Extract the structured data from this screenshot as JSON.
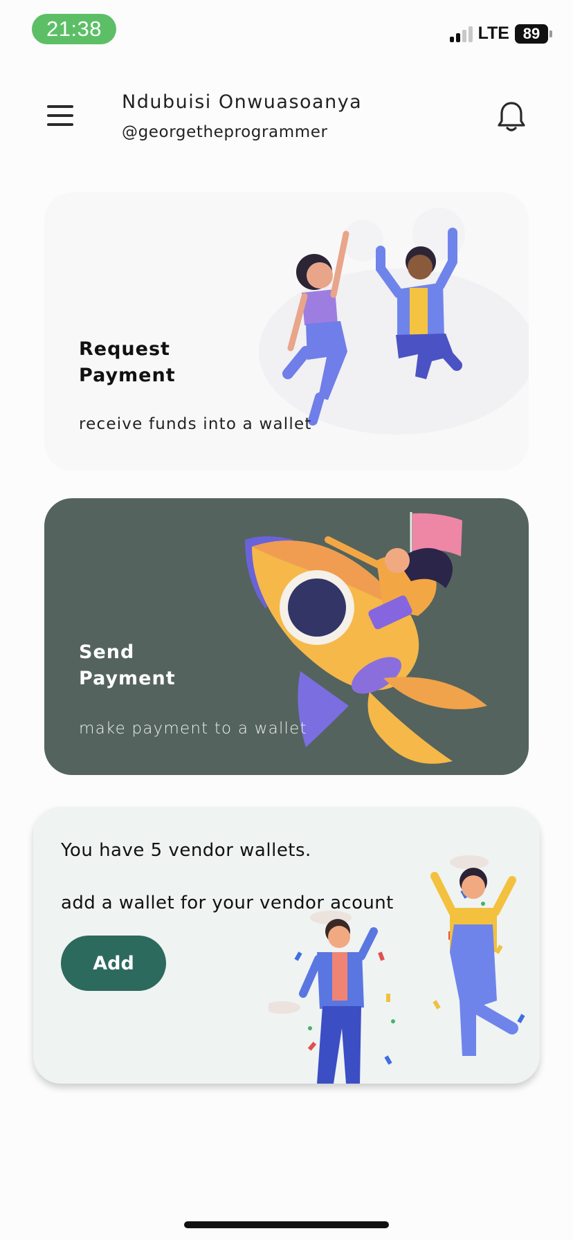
{
  "status_bar": {
    "time": "21:38",
    "network": "LTE",
    "battery": "89"
  },
  "header": {
    "name": "Ndubuisi Onwuasoanya",
    "handle": "@georgetheprogrammer"
  },
  "cards": {
    "request": {
      "title_line1": "Request",
      "title_line2": "Payment",
      "subtitle": "receive funds into a wallet"
    },
    "send": {
      "title_line1": "Send",
      "title_line2": "Payment",
      "subtitle": "make payment to a wallet"
    },
    "vendor": {
      "title": "You have 5 vendor wallets.",
      "subtitle": "add a wallet for your vendor acount",
      "button_label": "Add"
    }
  },
  "icons": {
    "menu": "hamburger-menu-icon",
    "notifications": "bell-icon"
  },
  "colors": {
    "time_pill": "#5cbf66",
    "send_card": "#54635e",
    "add_button": "#2c6a5e",
    "vendor_card": "#eff3f2"
  }
}
